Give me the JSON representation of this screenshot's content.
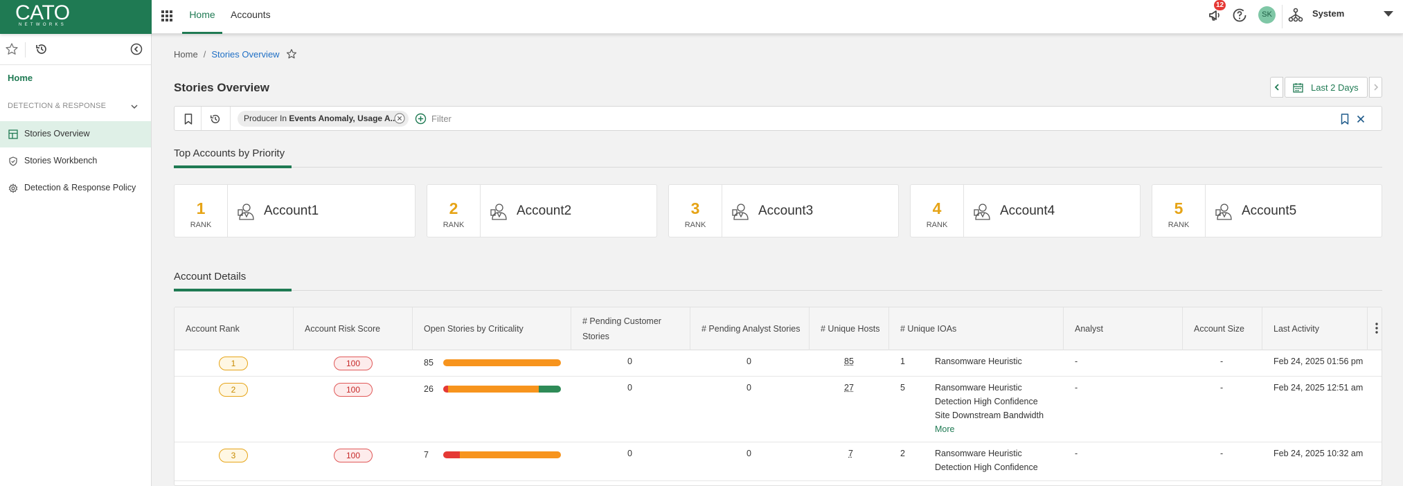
{
  "colors": {
    "brand": "#1f7a53",
    "rank": "#e6a417",
    "risk": "#c62828",
    "critical": "#e53935",
    "high": "#f7941d",
    "medium": "#2e8b57"
  },
  "logo": {
    "main": "CATO",
    "sub": "NETWORKS"
  },
  "topbar": {
    "tabs": [
      {
        "label": "Home",
        "active": true
      },
      {
        "label": "Accounts",
        "active": false
      }
    ],
    "notification_count": "12",
    "avatar_initials": "SK",
    "system_label": "System",
    "icons": [
      "apps-grid-icon",
      "megaphone-icon",
      "help-icon",
      "org-tree-icon",
      "caret-down-icon"
    ]
  },
  "sidebar": {
    "home_label": "Home",
    "section_label": "DETECTION & RESPONSE",
    "items": [
      {
        "label": "Stories Overview",
        "icon": "dashboard-icon",
        "active": true
      },
      {
        "label": "Stories Workbench",
        "icon": "shield-icon",
        "active": false
      },
      {
        "label": "Detection & Response Policy",
        "icon": "gear-icon",
        "active": false
      }
    ]
  },
  "breadcrumb": {
    "home": "Home",
    "current": "Stories Overview"
  },
  "page_title": "Stories Overview",
  "date_range": {
    "label": "Last 2 Days"
  },
  "filter": {
    "chip_prefix": "Producer In ",
    "chip_value": "Events Anomaly, Usage A...",
    "placeholder": "Filter"
  },
  "top_accounts": {
    "title": "Top Accounts by Priority",
    "rank_label": "RANK",
    "cards": [
      {
        "rank": "1",
        "name": "Account1"
      },
      {
        "rank": "2",
        "name": "Account2"
      },
      {
        "rank": "3",
        "name": "Account3"
      },
      {
        "rank": "4",
        "name": "Account4"
      },
      {
        "rank": "5",
        "name": "Account5"
      }
    ]
  },
  "account_details": {
    "title": "Account Details",
    "columns": [
      "Account Rank",
      "Account Risk Score",
      "Open Stories by Criticality",
      "# Pending Customer Stories",
      "# Pending Analyst Stories",
      "# Unique Hosts",
      "# Unique IOAs",
      "Analyst",
      "Account Size",
      "Last Activity"
    ],
    "rows": [
      {
        "rank": "1",
        "risk": "100",
        "open": "85",
        "crit": [
          0,
          1,
          0
        ],
        "pending_customer": "0",
        "pending_analyst": "0",
        "hosts": "85",
        "ioas": "1",
        "ioa_names": [
          "Ransomware Heuristic"
        ],
        "more": "",
        "analyst": "-",
        "size": "-",
        "last_activity": "Feb 24, 2025 01:56 pm"
      },
      {
        "rank": "2",
        "risk": "100",
        "open": "26",
        "crit": [
          0.04,
          0.77,
          0.19
        ],
        "pending_customer": "0",
        "pending_analyst": "0",
        "hosts": "27",
        "ioas": "5",
        "ioa_names": [
          "Ransomware Heuristic",
          "Detection High Confidence",
          "Site Downstream Bandwidth"
        ],
        "more": "More",
        "analyst": "-",
        "size": "-",
        "last_activity": "Feb 24, 2025 12:51 am"
      },
      {
        "rank": "3",
        "risk": "100",
        "open": "7",
        "crit": [
          0.14,
          0.86,
          0
        ],
        "pending_customer": "0",
        "pending_analyst": "0",
        "hosts": "7",
        "ioas": "2",
        "ioa_names": [
          "Ransomware Heuristic",
          "Detection High Confidence"
        ],
        "more": "",
        "analyst": "-",
        "size": "-",
        "last_activity": "Feb 24, 2025 10:32 am"
      }
    ]
  }
}
